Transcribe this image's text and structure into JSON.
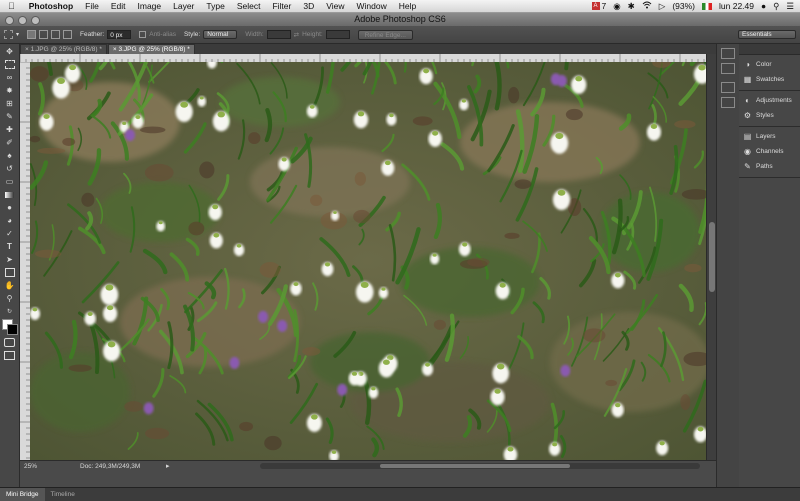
{
  "menubar": {
    "app_name": "Photoshop",
    "items": [
      "File",
      "Edit",
      "Image",
      "Layer",
      "Type",
      "Select",
      "Filter",
      "3D",
      "View",
      "Window",
      "Help"
    ],
    "status": {
      "adobe_count": "7",
      "battery": "(93%)",
      "clock": "lun 22.49"
    }
  },
  "window": {
    "title": "Adobe Photoshop CS6"
  },
  "options_bar": {
    "feather_label": "Feather:",
    "feather_value": "0 px",
    "anti_alias_label": "Anti-alias",
    "style_label": "Style:",
    "style_value": "Normal",
    "width_label": "Width:",
    "height_label": "Height:",
    "refine_edge_label": "Refine Edge...",
    "workspace_value": "Essentials"
  },
  "document_tabs": [
    {
      "label": "1.JPG @ 25% (RGB/8) *",
      "active": false
    },
    {
      "label": "3.JPG @ 25% (RGB/8) *",
      "active": true
    }
  ],
  "status_bar": {
    "zoom": "25%",
    "doc_info": "Doc: 249,3M/249,3M"
  },
  "bottom_panel": {
    "tabs": [
      "Mini Bridge",
      "Timeline"
    ]
  },
  "panels": {
    "group1": [
      "Color",
      "Swatches"
    ],
    "group2": [
      "Adjustments",
      "Styles"
    ],
    "group3": [
      "Layers",
      "Channels",
      "Paths"
    ]
  },
  "icons": {
    "apple": "apple-icon",
    "wifi": "wifi-icon",
    "volume": "volume-icon",
    "bluetooth": "bluetooth-icon",
    "search": "search-icon"
  },
  "colors": {
    "interface_dark": "#474747",
    "menubar": "#e6e6e6",
    "foreground": "#ffffff",
    "background": "#000000"
  }
}
